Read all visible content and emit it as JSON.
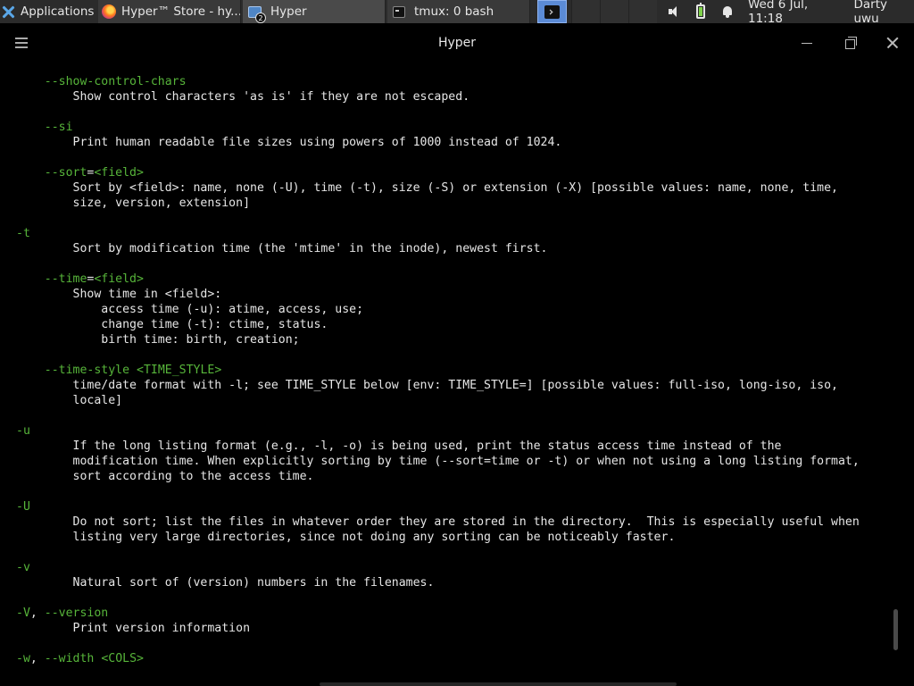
{
  "taskbar": {
    "apps_label": "Applications",
    "tasks": [
      {
        "label": "Hyper™ Store - hy..."
      },
      {
        "label": "Hyper",
        "badge": "2"
      },
      {
        "label": "tmux: 0 bash"
      }
    ],
    "clock": "Wed  6 Jul, 11:18",
    "user": "Darty uwu"
  },
  "window": {
    "title": "Hyper"
  },
  "terminal": {
    "option_color": "#57b53a",
    "text_color": "#e6e6e6",
    "lines": [
      [
        {
          "t": "    "
        },
        {
          "t": "--show-control-chars",
          "o": 1
        }
      ],
      [
        {
          "t": "        Show control characters 'as is' if they are not escaped."
        }
      ],
      [],
      [
        {
          "t": "    "
        },
        {
          "t": "--si",
          "o": 1
        }
      ],
      [
        {
          "t": "        Print human readable file sizes using powers of 1000 instead of 1024."
        }
      ],
      [],
      [
        {
          "t": "    "
        },
        {
          "t": "--sort",
          "o": 1
        },
        {
          "t": "="
        },
        {
          "t": "<field>",
          "o": 1
        }
      ],
      [
        {
          "t": "        Sort by <field>: name, none (-U), time (-t), size (-S) or extension (-X) [possible values: name, none, time,"
        }
      ],
      [
        {
          "t": "        size, version, extension]"
        }
      ],
      [],
      [
        {
          "t": "-t",
          "o": 1
        }
      ],
      [
        {
          "t": "        Sort by modification time (the 'mtime' in the inode), newest first."
        }
      ],
      [],
      [
        {
          "t": "    "
        },
        {
          "t": "--time",
          "o": 1
        },
        {
          "t": "="
        },
        {
          "t": "<field>",
          "o": 1
        }
      ],
      [
        {
          "t": "        Show time in <field>:"
        }
      ],
      [
        {
          "t": "            access time (-u): atime, access, use;"
        }
      ],
      [
        {
          "t": "            change time (-t): ctime, status."
        }
      ],
      [
        {
          "t": "            birth time: birth, creation;"
        }
      ],
      [],
      [
        {
          "t": "    "
        },
        {
          "t": "--time-style",
          "o": 1
        },
        {
          "t": " "
        },
        {
          "t": "<TIME_STYLE>",
          "o": 1
        }
      ],
      [
        {
          "t": "        time/date format with -l; see TIME_STYLE below [env: TIME_STYLE=] [possible values: full-iso, long-iso, iso,"
        }
      ],
      [
        {
          "t": "        locale]"
        }
      ],
      [],
      [
        {
          "t": "-u",
          "o": 1
        }
      ],
      [
        {
          "t": "        If the long listing format (e.g., -l, -o) is being used, print the status access time instead of the"
        }
      ],
      [
        {
          "t": "        modification time. When explicitly sorting by time (--sort=time or -t) or when not using a long listing format,"
        }
      ],
      [
        {
          "t": "        sort according to the access time."
        }
      ],
      [],
      [
        {
          "t": "-U",
          "o": 1
        }
      ],
      [
        {
          "t": "        Do not sort; list the files in whatever order they are stored in the directory.  This is especially useful when"
        }
      ],
      [
        {
          "t": "        listing very large directories, since not doing any sorting can be noticeably faster."
        }
      ],
      [],
      [
        {
          "t": "-v",
          "o": 1
        }
      ],
      [
        {
          "t": "        Natural sort of (version) numbers in the filenames."
        }
      ],
      [],
      [
        {
          "t": "-V",
          "o": 1
        },
        {
          "t": ", "
        },
        {
          "t": "--version",
          "o": 1
        }
      ],
      [
        {
          "t": "        Print version information"
        }
      ],
      [],
      [
        {
          "t": "-w",
          "o": 1
        },
        {
          "t": ", "
        },
        {
          "t": "--width",
          "o": 1
        },
        {
          "t": " "
        },
        {
          "t": "<COLS>",
          "o": 1
        }
      ]
    ]
  }
}
